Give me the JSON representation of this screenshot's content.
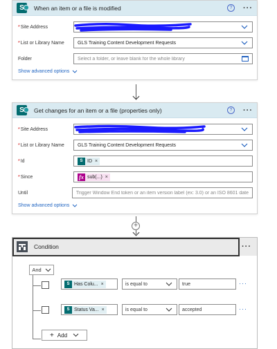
{
  "card1": {
    "title": "When an item or a file is modified",
    "fields": [
      {
        "label": "Site Address",
        "required": true,
        "value": ""
      },
      {
        "label": "List or Library Name",
        "required": true,
        "value": "GLS Training Content Development Requests"
      },
      {
        "label": "Folder",
        "required": false,
        "placeholder": "Select a folder, or leave blank for the whole library"
      }
    ],
    "advanced": "Show advanced options"
  },
  "card2": {
    "title": "Get changes for an item or a file (properties only)",
    "fields": [
      {
        "label": "Site Address",
        "required": true,
        "value": ""
      },
      {
        "label": "List or Library Name",
        "required": true,
        "value": "GLS Training Content Development Requests"
      },
      {
        "label": "Id",
        "required": true,
        "token": "ID"
      },
      {
        "label": "Since",
        "required": true,
        "token": "sub(...)"
      },
      {
        "label": "Until",
        "required": false,
        "placeholder": "Trigger Window End token or an item version label (ex: 3.0) or an ISO 8601 date"
      }
    ],
    "advanced": "Show advanced options"
  },
  "condition": {
    "title": "Condition",
    "group_operator": "And",
    "rows": [
      {
        "left": "Has Colu...",
        "operator": "is equal to",
        "right": "true"
      },
      {
        "left": "Status Va...",
        "operator": "is equal to",
        "right": "accepted"
      }
    ],
    "add_label": "Add"
  },
  "icons": {
    "sharepoint": "S",
    "help": "?",
    "more": "···",
    "fx": "fx",
    "close": "×",
    "plus": "+"
  },
  "colors": {
    "header_bg": "#d9eaf1",
    "sharepoint_teal": "#036c70",
    "link_blue": "#2266c2",
    "redact_blue": "#1a1aff",
    "fx_magenta": "#ad008c"
  }
}
